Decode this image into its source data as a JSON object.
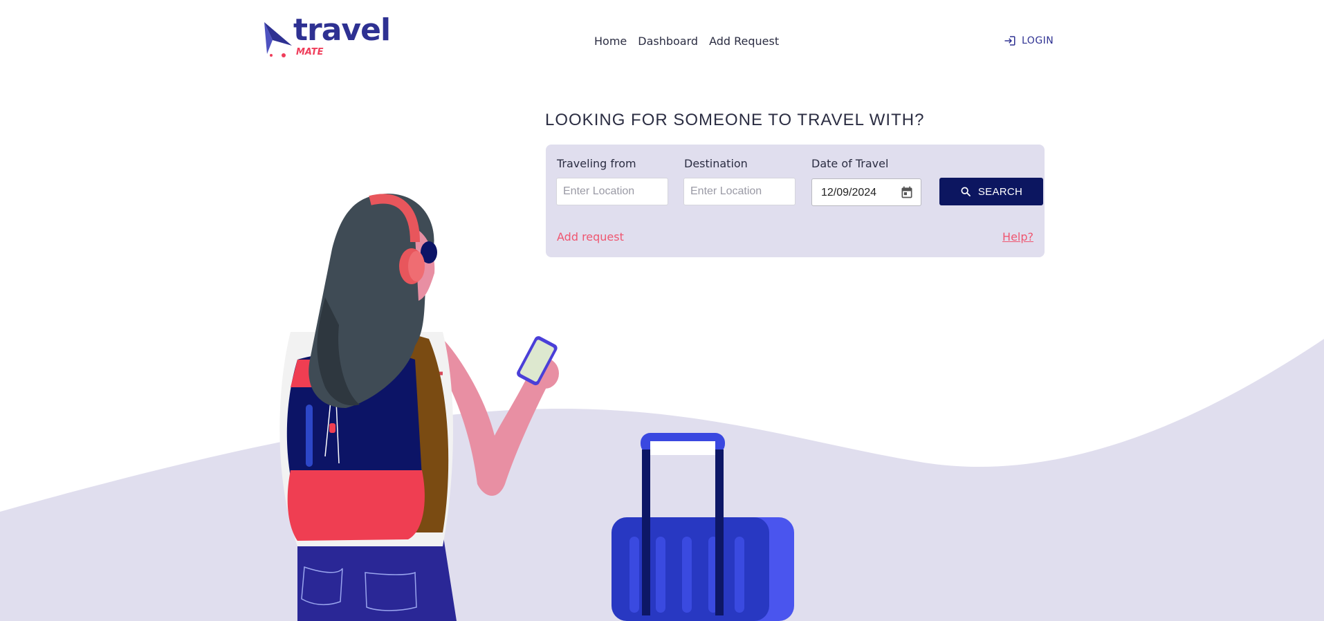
{
  "brand": {
    "word": "travel",
    "sub": "MATE",
    "accent": "#2e3192",
    "accent_secondary": "#ef3e5b"
  },
  "nav": {
    "items": [
      {
        "label": "Home"
      },
      {
        "label": "Dashboard"
      },
      {
        "label": "Add Request"
      }
    ]
  },
  "header": {
    "login_label": "LOGIN",
    "login_icon": "login-icon"
  },
  "search": {
    "headline": "LOOKING FOR SOMEONE TO TRAVEL WITH?",
    "from_label": "Traveling from",
    "from_placeholder": "Enter Location",
    "from_value": "",
    "destination_label": "Destination",
    "destination_placeholder": "Enter Location",
    "destination_value": "",
    "date_label": "Date of Travel",
    "date_value": "12/09/2024",
    "button_label": "SEARCH",
    "button_icon": "search-icon",
    "add_request_link": "Add request",
    "help_link": "Help?",
    "panel_color": "#e0deee",
    "button_color": "#0c1660",
    "link_color": "#ef5670"
  },
  "illustration": {
    "subject": "traveler-with-backpack-and-suitcase"
  }
}
